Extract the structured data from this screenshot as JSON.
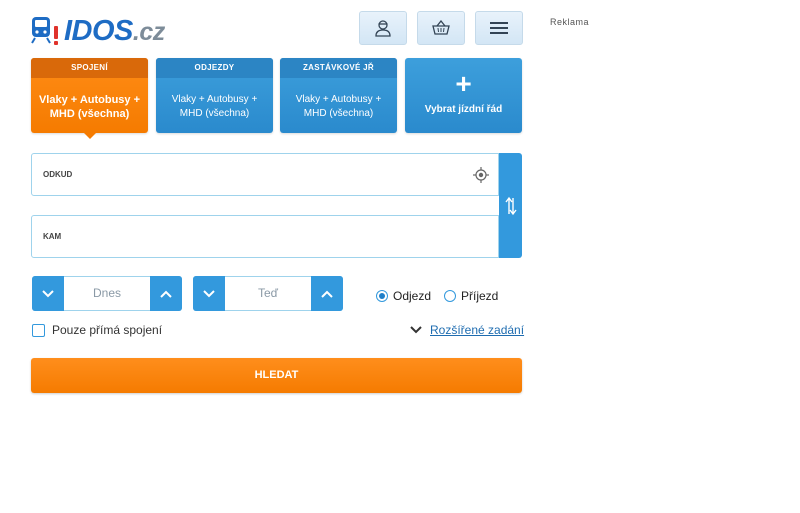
{
  "logo": {
    "name": "IDOS",
    "suffix": ".cz"
  },
  "header": {
    "ad_label": "Reklama",
    "icons": {
      "account": "person-icon",
      "basket": "basket-icon",
      "menu": "hamburger-menu-icon"
    }
  },
  "tabs": [
    {
      "head": "SPOJENÍ",
      "body": "Vlaky + Autobusy + MHD (všechna)",
      "active": true
    },
    {
      "head": "ODJEZDY",
      "body": "Vlaky + Autobusy + MHD (všechna)",
      "active": false
    },
    {
      "head": "ZASTÁVKOVÉ JŘ",
      "body": "Vlaky + Autobusy + MHD (všechna)",
      "active": false
    }
  ],
  "add_tab": {
    "plus": "+",
    "label": "Vybrat jízdní řád"
  },
  "form": {
    "from_label": "ODKUD",
    "to_label": "KAM",
    "date_value": "Dnes",
    "time_value": "Teď",
    "radio_departure": "Odjezd",
    "radio_arrival": "Příjezd",
    "selected_radio": "departure",
    "direct_only": "Pouze přímá spojení",
    "advanced": "Rozšířené zadání",
    "search_button": "HLEDAT"
  },
  "colors": {
    "primary_blue": "#3399dd",
    "orange": "#f57b00",
    "logo_blue": "#1e6cc4"
  }
}
